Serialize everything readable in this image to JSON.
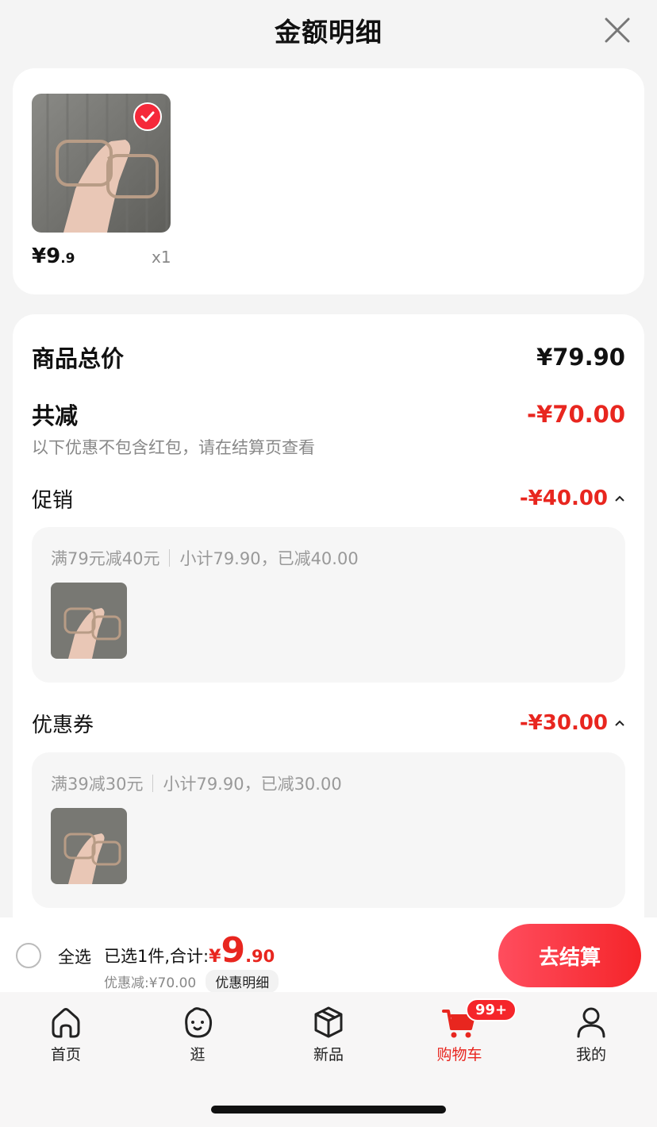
{
  "header": {
    "title": "金额明细"
  },
  "product": {
    "price_int": "¥9",
    "price_dec": ".9",
    "qty": "x1"
  },
  "summary": {
    "total_label": "商品总价",
    "total_value": "¥79.90",
    "reduce_label": "共减",
    "reduce_value": "-¥70.00",
    "note": "以下优惠不包含红包，请在结算页查看"
  },
  "promo": {
    "label": "促销",
    "value": "-¥40.00",
    "rule": "满79元减40元",
    "detail": "小计79.90，已减40.00"
  },
  "coupon": {
    "label": "优惠券",
    "value": "-¥30.00",
    "rule": "满39减30元",
    "detail": "小计79.90，已减30.00"
  },
  "bottom": {
    "select_all": "全选",
    "selected_label": "已选1件,合计:",
    "currency": "¥",
    "total_int": "9",
    "total_dec": ".90",
    "discount_text": "优惠减:¥70.00",
    "discount_detail_btn": "优惠明细",
    "checkout_btn": "去结算"
  },
  "tabs": [
    {
      "label": "首页",
      "icon": "home-icon"
    },
    {
      "label": "逛",
      "icon": "browse-face-icon"
    },
    {
      "label": "新品",
      "icon": "new-box-icon"
    },
    {
      "label": "购物车",
      "icon": "cart-icon",
      "badge": "99+"
    },
    {
      "label": "我的",
      "icon": "user-icon"
    }
  ],
  "colors": {
    "accent": "#e8261f",
    "checkout": "#f5252a"
  }
}
